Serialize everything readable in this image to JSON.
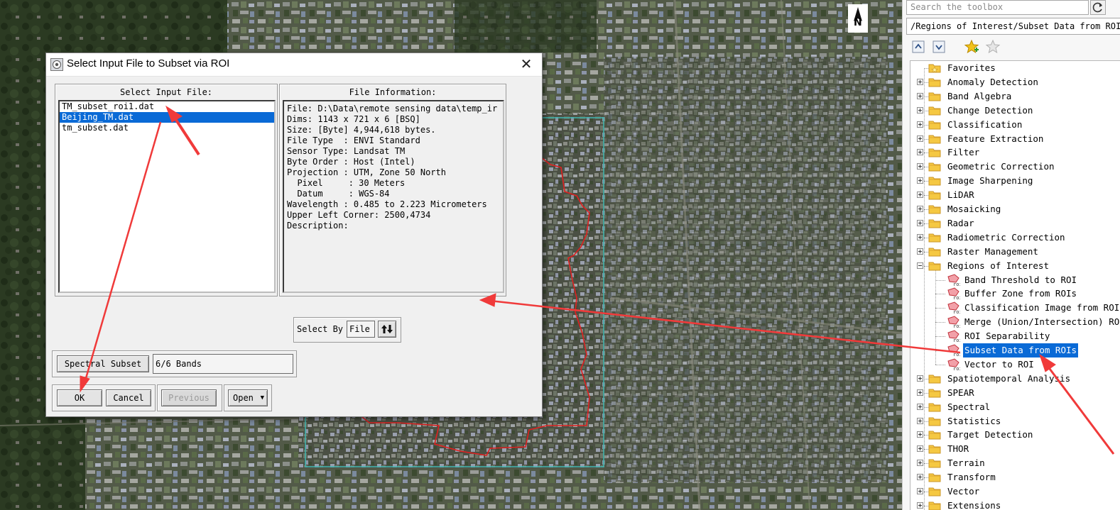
{
  "dialog": {
    "title": "Select Input File to Subset via ROI",
    "input_label": "Select Input File:",
    "files": [
      "TM_subset_roi1.dat",
      "Beijing_TM.dat",
      "tm_subset.dat"
    ],
    "selected_file": "Beijing_TM.dat",
    "info_label": "File Information:",
    "file_info": [
      "File: D:\\Data\\remote sensing data\\temp_ir",
      "Dims: 1143 x 721 x 6 [BSQ]",
      "Size: [Byte] 4,944,618 bytes.",
      "File Type  : ENVI Standard",
      "Sensor Type: Landsat TM",
      "Byte Order : Host (Intel)",
      "Projection : UTM, Zone 50 North",
      "  Pixel     : 30 Meters",
      "  Datum     : WGS-84",
      "Wavelength : 0.485 to 2.223 Micrometers",
      "Upper Left Corner: 2500,4734",
      "Description:"
    ],
    "select_by_label": "Select By",
    "select_by_value": "File",
    "spectral_subset_label": "Spectral Subset",
    "bands_value": "6/6 Bands",
    "ok_label": "OK",
    "cancel_label": "Cancel",
    "previous_label": "Previous",
    "open_label": "Open"
  },
  "toolbox": {
    "search_placeholder": "Search the toolbox",
    "path": "/Regions of Interest/Subset Data from ROIs",
    "top_items": [
      "Favorites",
      "Anomaly Detection",
      "Band Algebra",
      "Change Detection",
      "Classification",
      "Feature Extraction",
      "Filter",
      "Geometric Correction",
      "Image Sharpening",
      "LiDAR",
      "Mosaicking",
      "Radar",
      "Radiometric Correction",
      "Raster Management",
      "Regions of Interest"
    ],
    "roi_children": [
      "Band Threshold to ROI",
      "Buffer Zone from ROIs",
      "Classification Image from ROIs",
      "Merge (Union/Intersection) ROIs",
      "ROI Separability",
      "Subset Data from ROIs",
      "Vector to ROI"
    ],
    "selected_item": "Subset Data from ROIs",
    "bottom_items": [
      "Spatiotemporal Analysis",
      "SPEAR",
      "Spectral",
      "Statistics",
      "Target Detection",
      "THOR",
      "Terrain",
      "Transform",
      "Vector",
      "Extensions"
    ]
  },
  "map": {
    "north_label": "N"
  },
  "colors": {
    "selection": "#0a6ad6",
    "roi_boundary": "#e02020",
    "subset_extent": "#3fb6b0",
    "annotation_arrow": "#f03a3a"
  }
}
